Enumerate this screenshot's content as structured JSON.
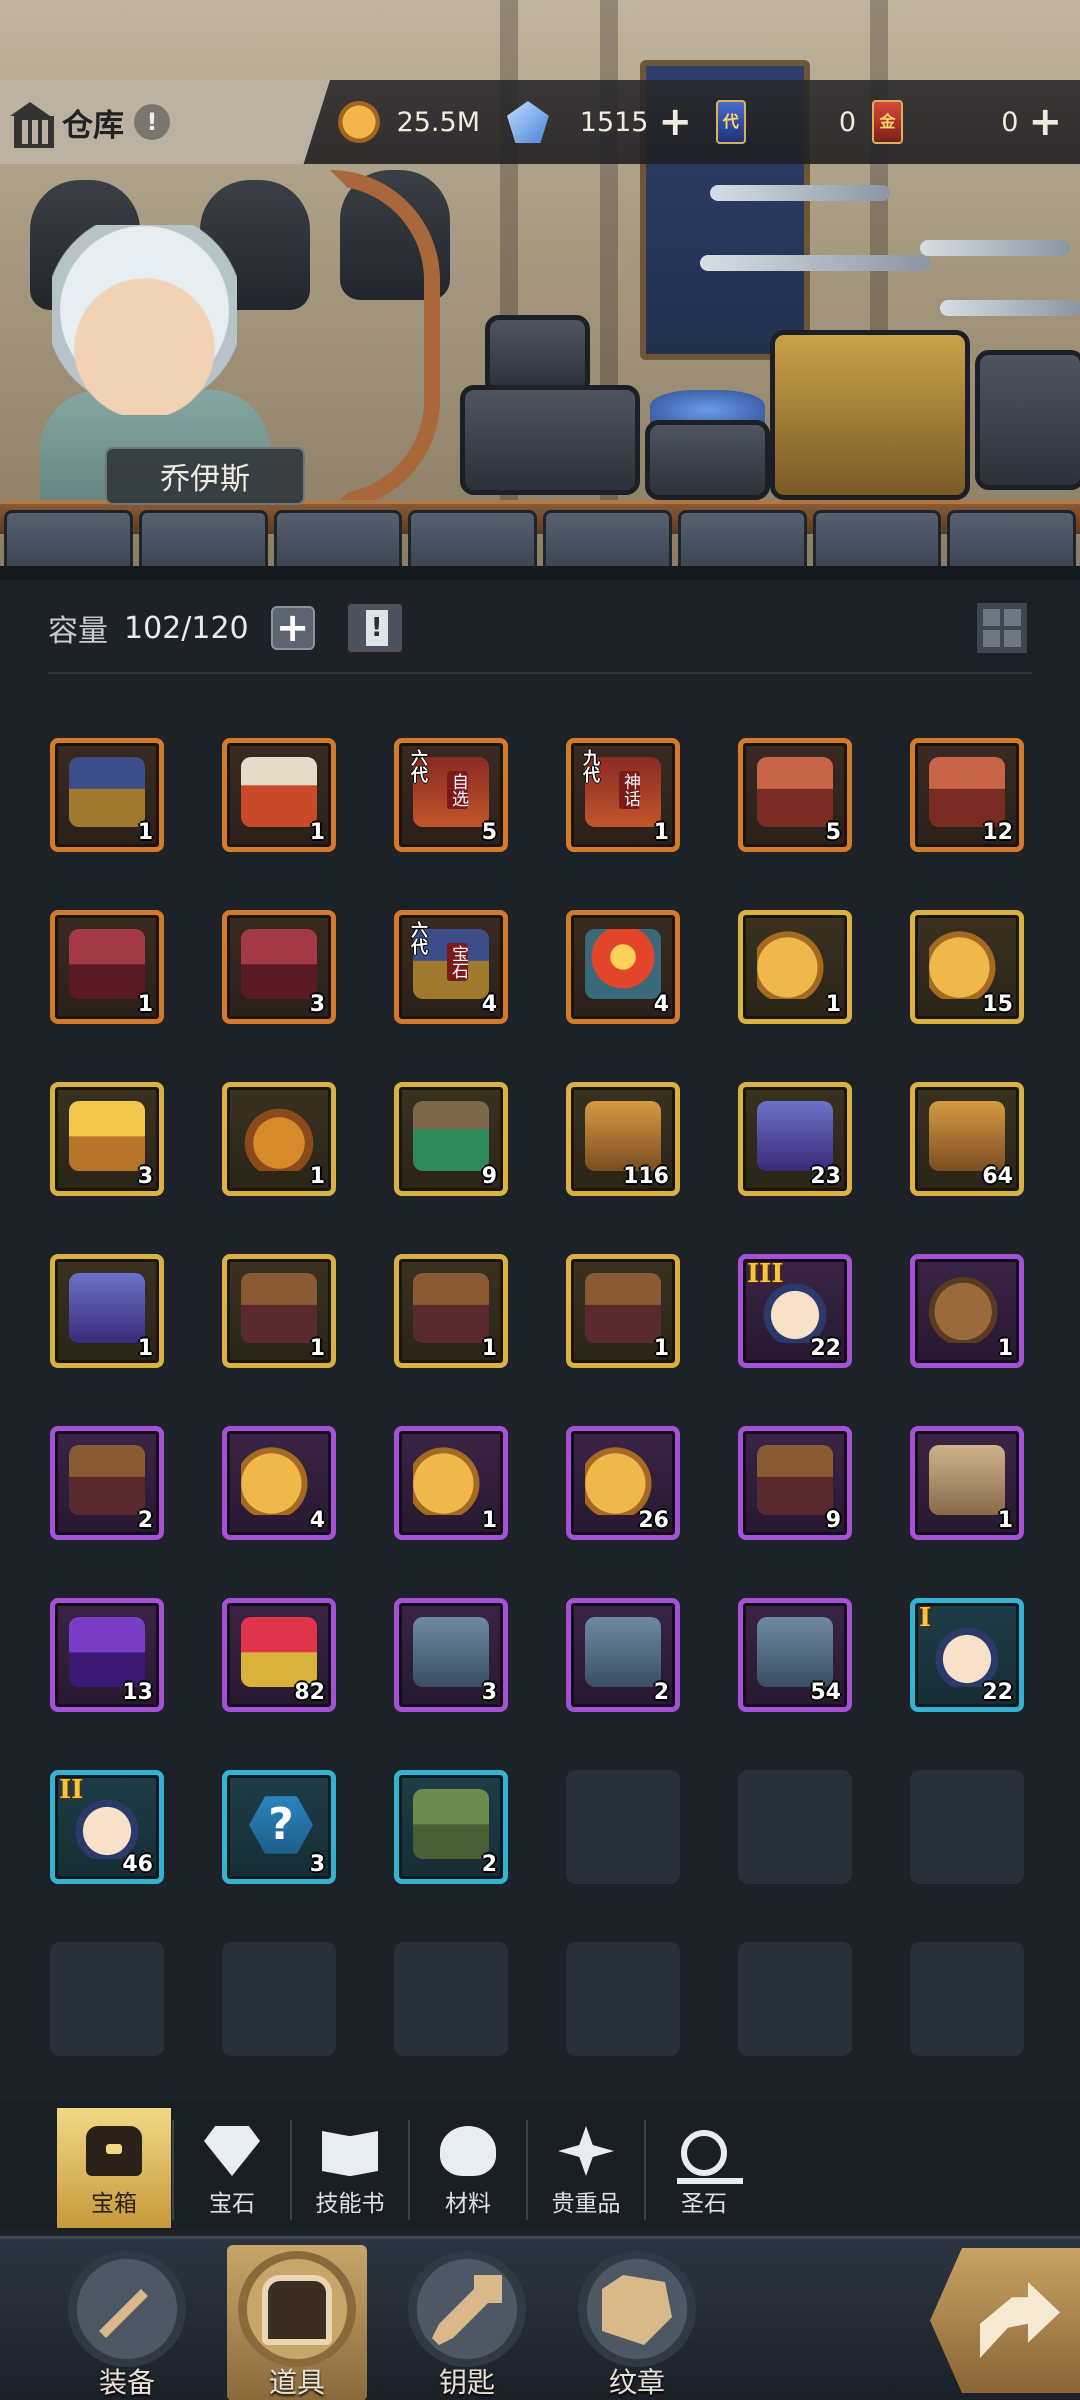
{
  "header": {
    "title": "仓库",
    "info_symbol": "!",
    "character_name": "乔伊斯"
  },
  "resources": {
    "gold": {
      "value": "25.5M",
      "icon": "gold-coin-icon"
    },
    "diamond": {
      "value": "1515",
      "icon": "blue-crystal-icon",
      "plus": "+"
    },
    "card_blue": {
      "value": "0",
      "icon": "blue-card-icon",
      "glyph": "代"
    },
    "card_red": {
      "value": "0",
      "icon": "red-card-icon",
      "glyph": "金",
      "plus": "+"
    }
  },
  "capacity": {
    "label": "容量",
    "value": "102/120",
    "plus": "+"
  },
  "inventory": [
    {
      "rarity": "orange",
      "art": "chest-blue",
      "qty": "1"
    },
    {
      "rarity": "orange",
      "art": "chest-crown",
      "qty": "1"
    },
    {
      "rarity": "orange",
      "art": "jar-red",
      "qty": "5",
      "tag": "六代",
      "tag2": "自选"
    },
    {
      "rarity": "orange",
      "art": "jar-red",
      "qty": "1",
      "tag": "九代",
      "tag2": "神话"
    },
    {
      "rarity": "orange",
      "art": "chest-red",
      "qty": "5"
    },
    {
      "rarity": "orange",
      "art": "chest-red",
      "qty": "12"
    },
    {
      "rarity": "orange",
      "art": "chest-maroon",
      "qty": "1"
    },
    {
      "rarity": "orange",
      "art": "chest-maroon",
      "qty": "3"
    },
    {
      "rarity": "orange",
      "art": "chest-blue",
      "qty": "4",
      "tag": "六代",
      "tag2": "宝石"
    },
    {
      "rarity": "orange",
      "art": "jar-fire",
      "qty": "4"
    },
    {
      "rarity": "gold",
      "art": "bag-gold",
      "qty": "1"
    },
    {
      "rarity": "gold",
      "art": "bag-gold",
      "qty": "15"
    },
    {
      "rarity": "gold",
      "art": "chest-gold",
      "qty": "3"
    },
    {
      "rarity": "gold",
      "art": "acorn",
      "qty": "1"
    },
    {
      "rarity": "gold",
      "art": "chest-green",
      "qty": "9"
    },
    {
      "rarity": "gold",
      "art": "jar-gold",
      "qty": "116"
    },
    {
      "rarity": "gold",
      "art": "jar-purple",
      "qty": "23"
    },
    {
      "rarity": "gold",
      "art": "jar-gold",
      "qty": "64"
    },
    {
      "rarity": "gold",
      "art": "jar-purple",
      "qty": "1"
    },
    {
      "rarity": "gold",
      "art": "chest-brown",
      "qty": "1"
    },
    {
      "rarity": "gold",
      "art": "chest-brown",
      "qty": "1"
    },
    {
      "rarity": "gold",
      "art": "chest-brown",
      "qty": "1"
    },
    {
      "rarity": "purple",
      "art": "egg",
      "qty": "22",
      "roman": "III"
    },
    {
      "rarity": "purple",
      "art": "bag-brown",
      "qty": "1"
    },
    {
      "rarity": "purple",
      "art": "chest-brown",
      "qty": "2"
    },
    {
      "rarity": "purple",
      "art": "bag-gold",
      "qty": "4"
    },
    {
      "rarity": "purple",
      "art": "bag-gold",
      "qty": "1"
    },
    {
      "rarity": "purple",
      "art": "bag-gold",
      "qty": "26"
    },
    {
      "rarity": "purple",
      "art": "chest-brown",
      "qty": "9"
    },
    {
      "rarity": "purple",
      "art": "backpack",
      "qty": "1"
    },
    {
      "rarity": "purple",
      "art": "chest-purple",
      "qty": "13"
    },
    {
      "rarity": "purple",
      "art": "chest-gift",
      "qty": "82"
    },
    {
      "rarity": "purple",
      "art": "jar-steel",
      "qty": "3"
    },
    {
      "rarity": "purple",
      "art": "jar-steel",
      "qty": "2"
    },
    {
      "rarity": "purple",
      "art": "jar-steel",
      "qty": "54"
    },
    {
      "rarity": "cyan",
      "art": "egg",
      "qty": "22",
      "roman": "I"
    },
    {
      "rarity": "cyan",
      "art": "egg",
      "qty": "46",
      "roman": "II"
    },
    {
      "rarity": "cyan",
      "art": "mystery",
      "qty": "3",
      "help": "?"
    },
    {
      "rarity": "cyan",
      "art": "chest-olive",
      "qty": "2"
    },
    {
      "rarity": "empty"
    },
    {
      "rarity": "empty"
    },
    {
      "rarity": "empty"
    },
    {
      "rarity": "empty"
    },
    {
      "rarity": "empty"
    },
    {
      "rarity": "empty"
    },
    {
      "rarity": "empty"
    },
    {
      "rarity": "empty"
    },
    {
      "rarity": "empty"
    }
  ],
  "categories": [
    {
      "label": "宝箱",
      "icon": "chest-icon",
      "active": true
    },
    {
      "label": "宝石",
      "icon": "gem-icon"
    },
    {
      "label": "技能书",
      "icon": "skill-book-icon"
    },
    {
      "label": "材料",
      "icon": "material-icon"
    },
    {
      "label": "贵重品",
      "icon": "valuables-icon"
    },
    {
      "label": "圣石",
      "icon": "holy-stone-icon"
    }
  ],
  "nav": [
    {
      "label": "装备",
      "icon": "equipment-icon"
    },
    {
      "label": "道具",
      "icon": "items-bag-icon",
      "active": true
    },
    {
      "label": "钥匙",
      "icon": "key-icon"
    },
    {
      "label": "纹章",
      "icon": "emblem-icon"
    }
  ],
  "colors": {
    "orange": "#d57a2a",
    "gold": "#d9b241",
    "purple": "#a451d8",
    "cyan": "#35b3d3",
    "active_tab": "#f1d884"
  }
}
